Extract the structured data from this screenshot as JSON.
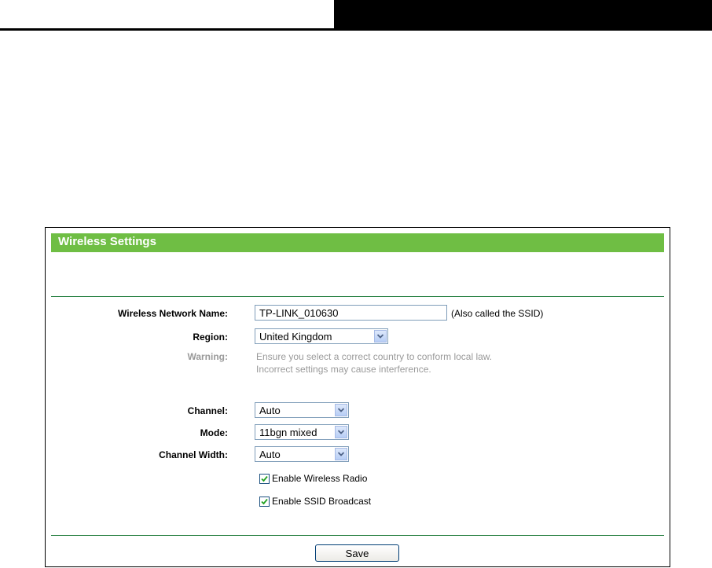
{
  "panel": {
    "title": "Wireless Settings"
  },
  "fields": {
    "ssid": {
      "label": "Wireless Network Name:",
      "value": "TP-LINK_010630",
      "note": "(Also called the SSID)"
    },
    "region": {
      "label": "Region:",
      "value": "United Kingdom"
    },
    "warning": {
      "label": "Warning:",
      "line1": "Ensure you select a correct country to conform local law.",
      "line2": "Incorrect settings may cause interference."
    },
    "channel": {
      "label": "Channel:",
      "value": "Auto"
    },
    "mode": {
      "label": "Mode:",
      "value": "11bgn mixed"
    },
    "channel_width": {
      "label": "Channel Width:",
      "value": "Auto"
    }
  },
  "checkboxes": {
    "wireless_radio": {
      "label": "Enable Wireless Radio",
      "checked": true
    },
    "ssid_broadcast": {
      "label": "Enable SSID Broadcast",
      "checked": true
    }
  },
  "buttons": {
    "save": "Save"
  },
  "colors": {
    "title_bar": "#6fbe44",
    "divider": "#1e7b3a"
  }
}
